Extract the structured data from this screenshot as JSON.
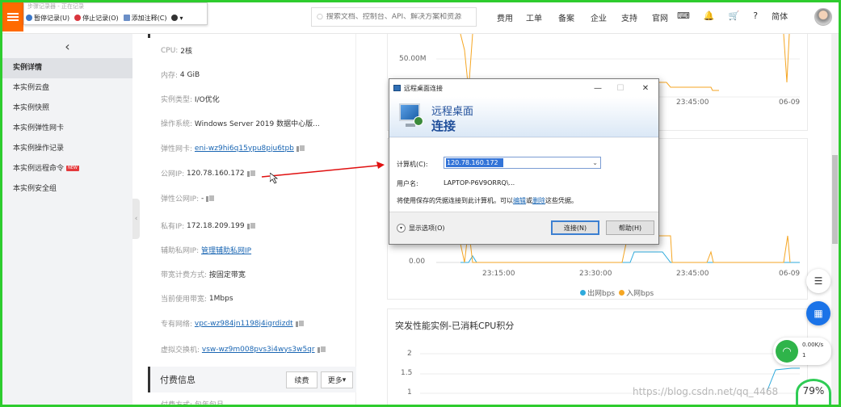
{
  "recorder": {
    "title": "步骤记录器 - 正在记录",
    "pause": "暂停记录(U)",
    "stop": "停止记录(O)",
    "comment": "添加注释(C)"
  },
  "search": {
    "placeholder": "搜索文档、控制台、API、解决方案和资源"
  },
  "nav": [
    "费用",
    "工单",
    "备案",
    "企业",
    "支持",
    "官网"
  ],
  "lang": "简体",
  "sidebar": {
    "items": [
      {
        "label": "实例详情",
        "active": true
      },
      {
        "label": "本实例云盘"
      },
      {
        "label": "本实例快照"
      },
      {
        "label": "本实例弹性网卡"
      },
      {
        "label": "本实例操作记录"
      },
      {
        "label": "本实例远程命令",
        "badge": "NEW"
      },
      {
        "label": "本实例安全组"
      }
    ]
  },
  "info": {
    "cpu_label": "CPU:",
    "cpu": "2核",
    "mem_label": "内存:",
    "mem": "4 GiB",
    "type_label": "实例类型:",
    "type": "I/O优化",
    "os_label": "操作系统:",
    "os": "Windows Server 2019 数据中心版...",
    "eni_label": "弹性网卡:",
    "eni": "eni-wz9hi6q15ypu8pju6tpb",
    "pubip_label": "公网IP:",
    "pubip": "120.78.160.172",
    "eip_label": "弹性公网IP:",
    "eip": "-",
    "priv_label": "私有IP:",
    "priv": "172.18.209.199",
    "aux_label": "辅助私网IP:",
    "aux": "管理辅助私网IP",
    "billing_label": "带宽计费方式:",
    "billing": "按固定带宽",
    "bw_label": "当前使用带宽:",
    "bw": "1Mbps",
    "vpc_label": "专有网络:",
    "vpc": "vpc-wz984jn1198j4igrdizdt",
    "vsw_label": "虚拟交换机:",
    "vsw": "vsw-wz9m008pvs3i4wys3w5qr",
    "pay_title": "付费信息",
    "renew": "续费",
    "more": "更多",
    "pay_row": "付费方式: 包年包月"
  },
  "chart1": {
    "y_label": "50.00M",
    "ticks": [
      "23:45:00",
      "06-09"
    ]
  },
  "chart2": {
    "y_label": "0.00",
    "ticks": [
      "23:15:00",
      "23:30:00",
      "23:45:00",
      "06-09"
    ],
    "legend": [
      "出网bps",
      "入网bps"
    ]
  },
  "chart3": {
    "title": "突发性能实例-已消耗CPU积分",
    "y": [
      "2",
      "1.5",
      "1"
    ]
  },
  "chart_data": [
    {
      "type": "line",
      "x": [
        "23:15:00",
        "23:30:00",
        "23:45:00",
        "06-09"
      ],
      "series": [
        {
          "name": "出网bps"
        },
        {
          "name": "入网bps"
        }
      ]
    }
  ],
  "rdp": {
    "title": "远程桌面连接",
    "banner1": "远程桌面",
    "banner2": "连接",
    "computer_label": "计算机(C):",
    "computer": "120.78.160.172",
    "user_label": "用户名:",
    "user": "LAPTOP-P6V9ORRQ\\...",
    "note_a": "将使用保存的凭据连接到此计算机。可以",
    "edit": "编辑",
    "or": "或",
    "del": "删除",
    "note_b": "这些凭据。",
    "options": "显示选项(O)",
    "connect": "连接(N)",
    "help": "帮助(H)"
  },
  "widgets": {
    "speed": "0.00K/s",
    "count": "1",
    "percent": "79%"
  },
  "watermark": "https://blog.csdn.net/qq_4468",
  "colors": {
    "accent": "#ff6a00",
    "link": "#1a66b3",
    "series_out": "#2eaadc",
    "series_in": "#f5a623"
  }
}
